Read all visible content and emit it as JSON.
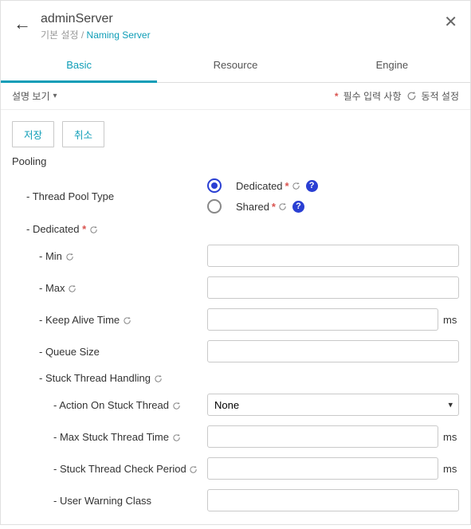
{
  "header": {
    "title": "adminServer",
    "crumb1": "기본 설정",
    "crumb_sep": "/",
    "crumb2": "Naming Server"
  },
  "tabs": {
    "basic": "Basic",
    "resource": "Resource",
    "engine": "Engine"
  },
  "legend": {
    "view": "설명 보기",
    "required": "필수 입력 사항",
    "dynamic": "동적 설정"
  },
  "buttons": {
    "save": "저장",
    "cancel": "취소"
  },
  "section": {
    "pooling": "Pooling"
  },
  "labels": {
    "thread_pool_type": "- Thread Pool Type",
    "dedicated": "- Dedicated",
    "min": "- Min",
    "max": "- Max",
    "keep_alive": "- Keep Alive Time",
    "queue_size": "- Queue Size",
    "stuck_handling": "- Stuck Thread Handling",
    "action_stuck": "- Action On Stuck Thread",
    "max_stuck_time": "- Max Stuck Thread Time",
    "stuck_check_period": "- Stuck Thread Check Period",
    "user_warning_class": "- User Warning Class"
  },
  "radios": {
    "dedicated": "Dedicated",
    "shared": "Shared",
    "selected": "dedicated"
  },
  "fields": {
    "min": "",
    "max": "",
    "keep_alive": "",
    "queue_size": "",
    "action_stuck": "None",
    "max_stuck_time": "",
    "stuck_check_period": "",
    "user_warning_class": ""
  },
  "units": {
    "ms": "ms"
  },
  "symbols": {
    "star": "*",
    "help": "?"
  },
  "colors": {
    "accent": "#0e9db7",
    "required": "#d9534f",
    "radio": "#2a3fd3"
  }
}
